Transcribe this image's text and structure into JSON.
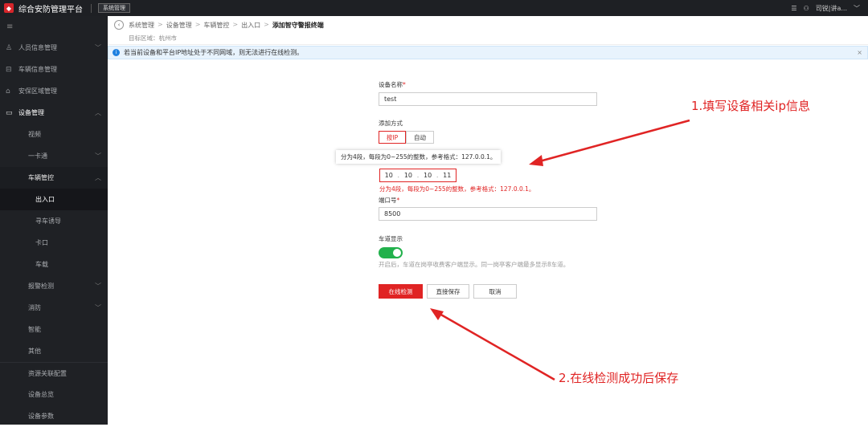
{
  "topbar": {
    "app_title": "综合安防管理平台",
    "system_btn": "系统管理",
    "user_text": "司锐|讲a..."
  },
  "sidebar": {
    "items": [
      {
        "label": "人员信息管理",
        "icon": "person-icon",
        "chev": "﹀"
      },
      {
        "label": "车辆信息管理",
        "icon": "car-icon"
      },
      {
        "label": "安保区域管理",
        "icon": "home-icon"
      },
      {
        "label": "设备管理",
        "icon": "device-icon",
        "chev": "︿"
      },
      {
        "label": "视频"
      },
      {
        "label": "一卡通",
        "chev": "﹀"
      },
      {
        "label": "车辆管控",
        "chev": "︿"
      },
      {
        "label": "出入口"
      },
      {
        "label": "寻车诱导"
      },
      {
        "label": "卡口"
      },
      {
        "label": "车载"
      },
      {
        "label": "报警检测",
        "chev": "﹀"
      },
      {
        "label": "消防",
        "chev": "﹀"
      },
      {
        "label": "智能"
      },
      {
        "label": "其他"
      },
      {
        "label": "资源关联配置"
      },
      {
        "label": "设备总览"
      },
      {
        "label": "设备参数"
      }
    ]
  },
  "breadcrumb": {
    "items": [
      "系统管理",
      "设备管理",
      "车辆管控",
      "出入口"
    ],
    "current": "添加智守警报终端",
    "separator": ">"
  },
  "target_area": "目标区域：杭州市",
  "notice": {
    "text": "若当前设备和平台IP地址处于不同网域，则无法进行在线检测。",
    "close": "×",
    "color": "#1f81e0"
  },
  "form": {
    "device_name_label": "设备名称",
    "device_name_value": "test",
    "add_method_label": "添加方式",
    "method_ip": "按IP",
    "method_auto": "自动",
    "ip_tooltip": "分为4段，每段为0~255的整数，参考格式：127.0.0.1。",
    "ip_segments": [
      "10",
      "10",
      "10",
      "11"
    ],
    "ip_error": "分为4段，每段为0~255的整数，参考格式：127.0.0.1。",
    "port_label": "端口号",
    "port_value": "8500",
    "lane_label": "车道显示",
    "lane_on": true,
    "lane_hint": "开启后，车道在岗亭收费客户端显示。同一岗亭客户端最多显示8车道。",
    "btn_online_check": "在线检测",
    "btn_save": "直接保存",
    "btn_cancel": "取消"
  },
  "annotations": {
    "note1": "1.填写设备相关ip信息",
    "note2": "2.在线检测成功后保存",
    "color": "#e02424"
  }
}
